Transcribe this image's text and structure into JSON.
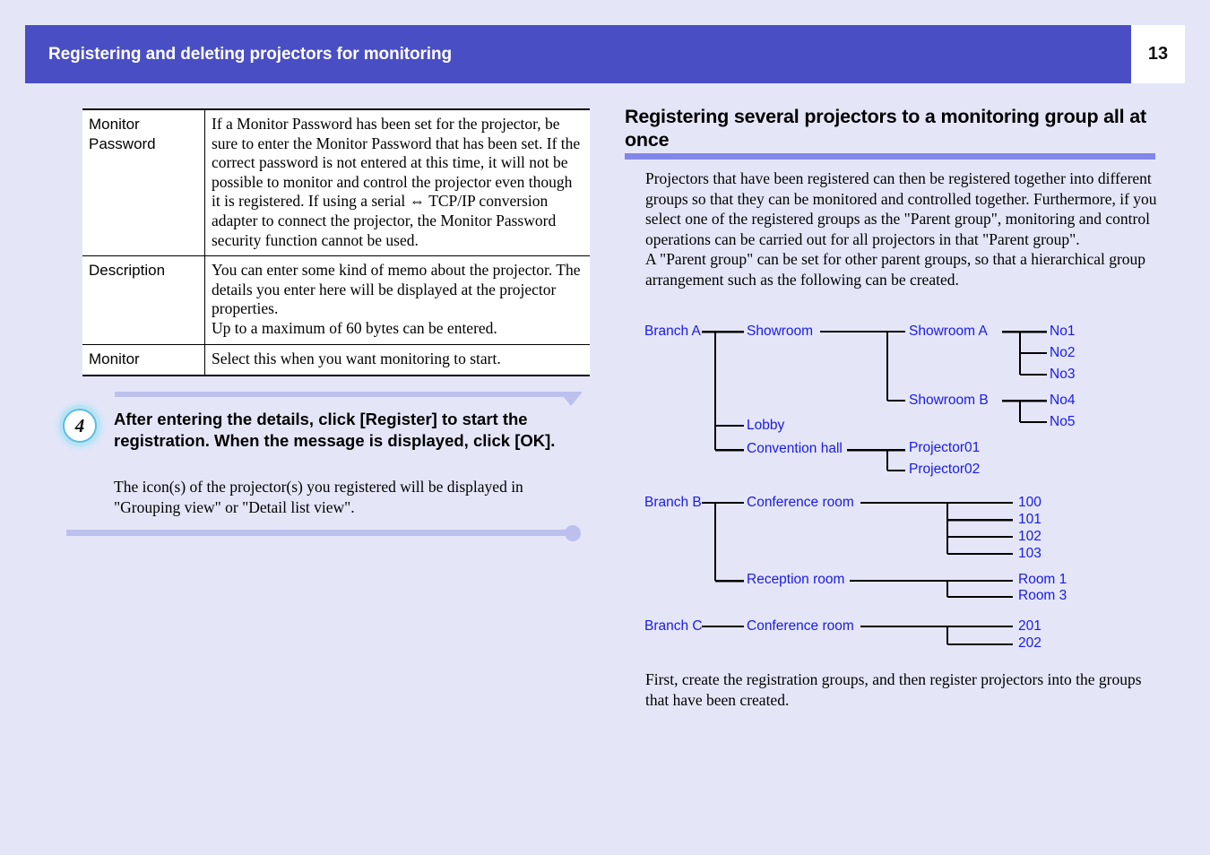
{
  "header": {
    "title": "Registering and deleting projectors for monitoring",
    "page_number": "13"
  },
  "spec_table": {
    "rows": [
      {
        "label": "Monitor Password",
        "description": "If a Monitor Password has been set for the projector, be sure to enter the Monitor Password that has been set. If the correct password is not entered at this time, it will not be possible to monitor and control the projector even though it is registered. If using a serial ⇔ TCP/IP conversion adapter to connect the projector, the Monitor Password security function cannot be used."
      },
      {
        "label": "Description",
        "description": "You can enter some kind of memo about the projector. The details you enter here will be displayed at the projector properties.\nUp to a maximum of 60 bytes can be entered."
      },
      {
        "label": "Monitor",
        "description": "Select this when you want monitoring to start."
      }
    ]
  },
  "step": {
    "number": "4",
    "heading": "After entering the details, click [Register] to start the registration. When the message is displayed, click [OK].",
    "body": "The icon(s) of the projector(s) you registered will be displayed in \"Grouping view\" or \"Detail list view\"."
  },
  "section": {
    "title": "Registering several projectors to a monitoring group all at once",
    "paragraph1": "Projectors that have been registered can then be registered together into different groups so that they can be monitored and controlled together. Furthermore, if you select one of the registered groups as the \"Parent group\", monitoring and control operations can be carried out for all projectors in that \"Parent group\".\nA \"Parent group\" can be set for other parent groups, so that a hierarchical group arrangement such as the following can be created.",
    "paragraph2": "First, create the registration groups, and then register projectors into the groups that have been created."
  },
  "tree": {
    "line_color": "#000000",
    "label_color": "#1a1ae8",
    "nodes": {
      "branch_a": "Branch A",
      "showroom": "Showroom",
      "showroom_a": "Showroom A",
      "no1": "No1",
      "no2": "No2",
      "no3": "No3",
      "showroom_b": "Showroom B",
      "no4": "No4",
      "no5": "No5",
      "lobby": "Lobby",
      "convention_hall": "Convention hall",
      "projector01": "Projector01",
      "projector02": "Projector02",
      "branch_b": "Branch B",
      "conference_room_b": "Conference room",
      "p100": "100",
      "p101": "101",
      "p102": "102",
      "p103": "103",
      "reception_room": "Reception room",
      "room1": "Room 1",
      "room3": "Room 3",
      "branch_c": "Branch C",
      "conference_room_c": "Conference room",
      "p201": "201",
      "p202": "202"
    }
  },
  "colors": {
    "page_background": "#e4e6f8",
    "header_bar": "#4a4ec4",
    "section_rule": "#8186e8",
    "step_rule": "#bdc0ee",
    "badge_ring": "#5bbde0"
  }
}
